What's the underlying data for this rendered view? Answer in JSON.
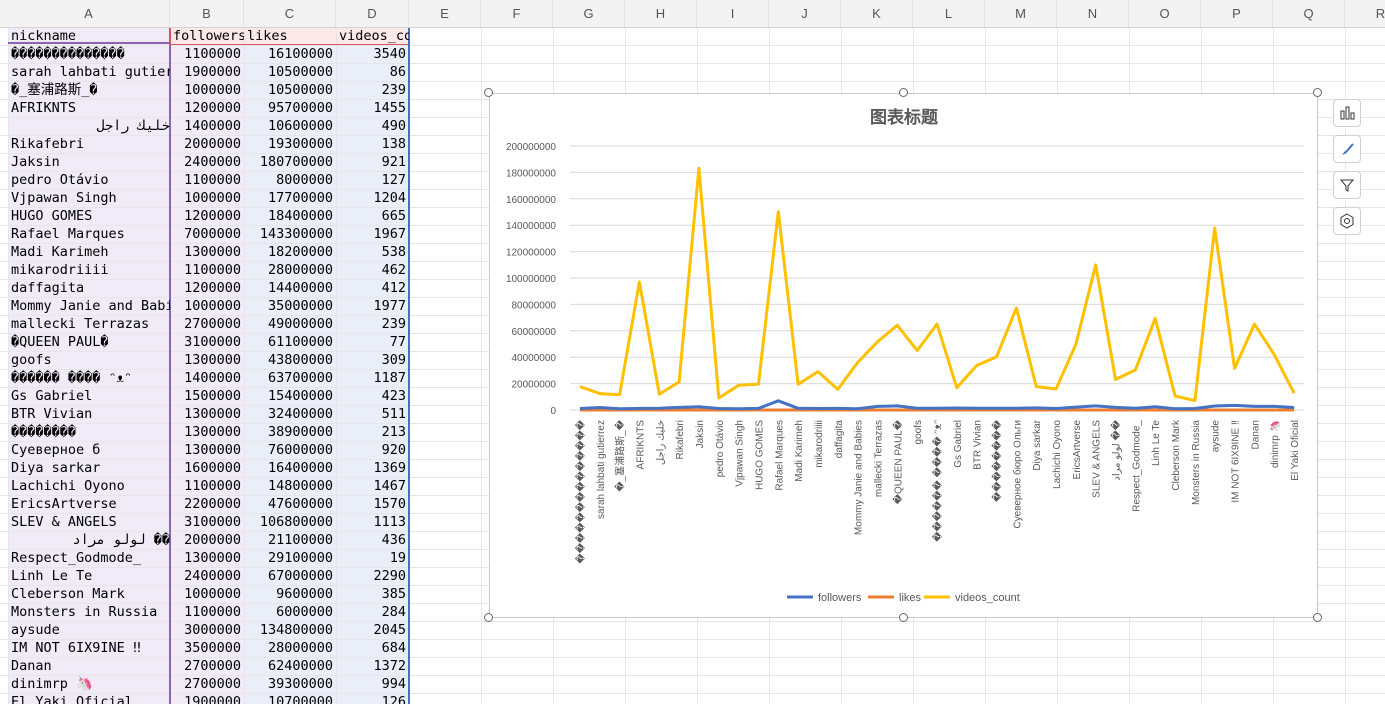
{
  "columns": [
    "A",
    "B",
    "C",
    "D",
    "E",
    "F",
    "G",
    "H",
    "I",
    "J",
    "K",
    "L",
    "M",
    "N",
    "O",
    "P",
    "Q",
    "R"
  ],
  "header_row": {
    "nickname": "nickname",
    "followers": "followers",
    "likes": "likes",
    "videos_count": "videos_count"
  },
  "rows": [
    [
      "��������������",
      "1100000",
      "16100000",
      "3540"
    ],
    [
      "sarah lahbati gutier",
      "1900000",
      "10500000",
      "86"
    ],
    [
      "�_塞浦路斯_�",
      "1000000",
      "10500000",
      "239"
    ],
    [
      "AFRIKNTS",
      "1200000",
      "95700000",
      "1455"
    ],
    [
      "خليك راجل",
      "1400000",
      "10600000",
      "490"
    ],
    [
      "Rikafebri",
      "2000000",
      "19300000",
      "138"
    ],
    [
      "Jaksin",
      "2400000",
      "180700000",
      "921"
    ],
    [
      "pedro Otávio",
      "1100000",
      "8000000",
      "127"
    ],
    [
      "Vjpawan Singh",
      "1000000",
      "17700000",
      "1204"
    ],
    [
      "HUGO GOMES",
      "1200000",
      "18400000",
      "665"
    ],
    [
      "Rafael Marques",
      "7000000",
      "143300000",
      "1967"
    ],
    [
      "Madi Karimeh",
      "1300000",
      "18200000",
      "538"
    ],
    [
      "mikarodriiii",
      "1100000",
      "28000000",
      "462"
    ],
    [
      "daffagita",
      "1200000",
      "14400000",
      "412"
    ],
    [
      "Mommy Janie and Babi",
      "1000000",
      "35000000",
      "1977"
    ],
    [
      "mallecki Terrazas",
      "2700000",
      "49000000",
      "239"
    ],
    [
      "�QUEEN PAUL�",
      "3100000",
      "61100000",
      "77"
    ],
    [
      "goofs",
      "1300000",
      "43800000",
      "309"
    ],
    [
      "������ ���� ᵔᴥᵔ",
      "1400000",
      "63700000",
      "1187"
    ],
    [
      "Gs Gabriel",
      "1500000",
      "15400000",
      "423"
    ],
    [
      "BTR Vivian",
      "1300000",
      "32400000",
      "511"
    ],
    [
      "��������",
      "1300000",
      "38900000",
      "213"
    ],
    [
      "Суеверное б",
      "1300000",
      "76000000",
      "920"
    ],
    [
      "Diya sarkar",
      "1600000",
      "16400000",
      "1369"
    ],
    [
      "Lachichi Oyono",
      "1100000",
      "14800000",
      "1467"
    ],
    [
      "EricsArtverse",
      "2200000",
      "47600000",
      "1570"
    ],
    [
      "SLEV & ANGELS",
      "3100000",
      "106800000",
      "1113"
    ],
    [
      "لولو مراد ��",
      "2000000",
      "21100000",
      "436"
    ],
    [
      "Respect_Godmode_",
      "1300000",
      "29100000",
      "19"
    ],
    [
      "Linh Le Te",
      "2400000",
      "67000000",
      "2290"
    ],
    [
      "Cleberson Mark",
      "1000000",
      "9600000",
      "385"
    ],
    [
      "Monsters in Russia",
      "1100000",
      "6000000",
      "284"
    ],
    [
      "aysude",
      "3000000",
      "134800000",
      "2045"
    ],
    [
      "IM NOT 6IX9INE ‼",
      "3500000",
      "28000000",
      "684"
    ],
    [
      "Danan",
      "2700000",
      "62400000",
      "1372"
    ],
    [
      "dinimrp 🦄",
      "2700000",
      "39300000",
      "994"
    ],
    [
      "El Yaki Oficial",
      "1900000",
      "10700000",
      "126"
    ]
  ],
  "chart": {
    "title": "图表标题",
    "y_ticks": [
      "0",
      "20000000",
      "40000000",
      "60000000",
      "80000000",
      "100000000",
      "120000000",
      "140000000",
      "160000000",
      "180000000",
      "200000000"
    ],
    "legend": [
      "followers",
      "likes",
      "videos_count"
    ],
    "colors": {
      "followers": "#4472c4",
      "likes": "#ed7d31",
      "videos_count": "#ffc000"
    }
  },
  "chart_data": {
    "type": "line",
    "title": "图表标题",
    "ylim": [
      0,
      200000000
    ],
    "categories": [
      "��������������",
      "sarah lahbati gutierrez",
      "�_塞浦路斯_�",
      "AFRIKNTS",
      "خليك راجل",
      "Rikafebri",
      "Jaksin",
      "pedro Otávio",
      "Vjpawan Singh",
      "HUGO GOMES",
      "Rafael Marques",
      "Madi Karimeh",
      "mikarodriiii",
      "daffagita",
      "Mommy Janie and Babies",
      "mallecki Terrazas",
      "�QUEEN PAUL�",
      "goofs",
      "������ ���� ᵔᴥᵔ",
      "Gs Gabriel",
      "BTR Vivian",
      "��������",
      "Суеверное бюро Ольги",
      "Diya sarkar",
      "Lachichi Oyono",
      "EricsArtverse",
      "SLEV & ANGELS",
      "لولو مراد ��",
      "Respect_Godmode_",
      "Linh Le Te",
      "Cleberson Mark",
      "Monsters in Russia",
      "aysude",
      "IM NOT 6IX9INE ‼",
      "Danan",
      "dinimrp 🦄",
      "El Yaki Oficial"
    ],
    "series": [
      {
        "name": "followers",
        "values": [
          1100000,
          1900000,
          1000000,
          1200000,
          1400000,
          2000000,
          2400000,
          1100000,
          1000000,
          1200000,
          7000000,
          1300000,
          1100000,
          1200000,
          1000000,
          2700000,
          3100000,
          1300000,
          1400000,
          1500000,
          1300000,
          1300000,
          1300000,
          1600000,
          1100000,
          2200000,
          3100000,
          2000000,
          1300000,
          2400000,
          1000000,
          1100000,
          3000000,
          3500000,
          2700000,
          2700000,
          1900000
        ]
      },
      {
        "name": "likes",
        "values": [
          3540,
          86,
          239,
          1455,
          490,
          138,
          921,
          127,
          1204,
          665,
          1967,
          538,
          462,
          412,
          1977,
          239,
          77,
          309,
          1187,
          423,
          511,
          213,
          920,
          1369,
          1467,
          1570,
          1113,
          436,
          19,
          2290,
          385,
          284,
          2045,
          684,
          1372,
          994,
          126
        ]
      },
      {
        "name": "videos_count",
        "values": [
          17700000,
          12400000,
          11500000,
          97000000,
          12000000,
          21300000,
          183100000,
          9100000,
          18700000,
          19600000,
          150300000,
          19500000,
          29100000,
          15600000,
          36000000,
          51700000,
          64200000,
          45100000,
          65100000,
          16900000,
          33700000,
          40200000,
          77300000,
          17800000,
          15900000,
          49800000,
          109900000,
          23100000,
          30400000,
          69400000,
          10600000,
          7100000,
          137800000,
          31500000,
          65100000,
          42000000,
          12800000
        ]
      }
    ]
  }
}
